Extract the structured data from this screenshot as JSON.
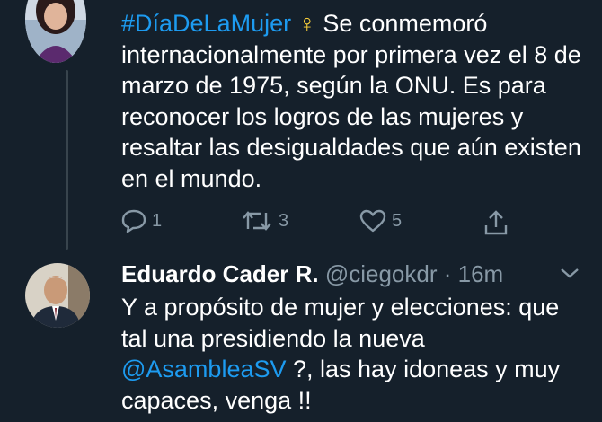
{
  "tweet1": {
    "header_partial": "",
    "hashtag": "#DíaDeLaMujer",
    "venus": "♀",
    "body": " Se conmemoró internacionalmente por primera vez el 8 de marzo de 1975, según la ONU. Es para reconocer los logros de las mujeres y resaltar las desigualdades que aún existen en el mundo.",
    "replies": "1",
    "retweets": "3",
    "likes": "5"
  },
  "tweet2": {
    "name": "Eduardo Cader R.",
    "handle": "@ciegokdr",
    "separator": " · ",
    "time": "16m",
    "text_before": "Y a propósito de mujer y elecciones: que tal una presidiendo la nueva ",
    "mention": "@AsambleaSV",
    "text_after": " ?, las hay idoneas y muy capaces, venga !!"
  },
  "colors": {
    "background": "#15202b",
    "accent": "#1d9bf0",
    "muted": "#8899a6",
    "venus": "#ffd43b"
  },
  "icons": [
    "reply-icon",
    "retweet-icon",
    "like-icon",
    "share-icon",
    "chevron-down-icon"
  ]
}
